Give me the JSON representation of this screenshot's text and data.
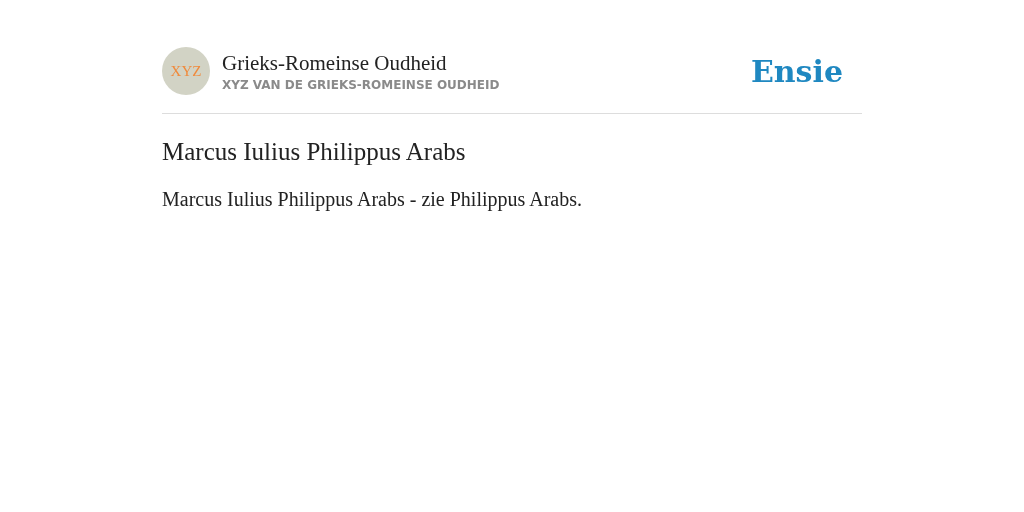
{
  "header": {
    "avatar": "XYZ",
    "title": "Grieks-Romeinse Oudheid",
    "subtitle": "XYZ VAN DE GRIEKS-ROMEINSE OUDHEID",
    "logo": "Ensie"
  },
  "article": {
    "heading": "Marcus Iulius Philippus Arabs",
    "body": "Marcus Iulius Philippus Arabs - zie Philippus Arabs."
  }
}
